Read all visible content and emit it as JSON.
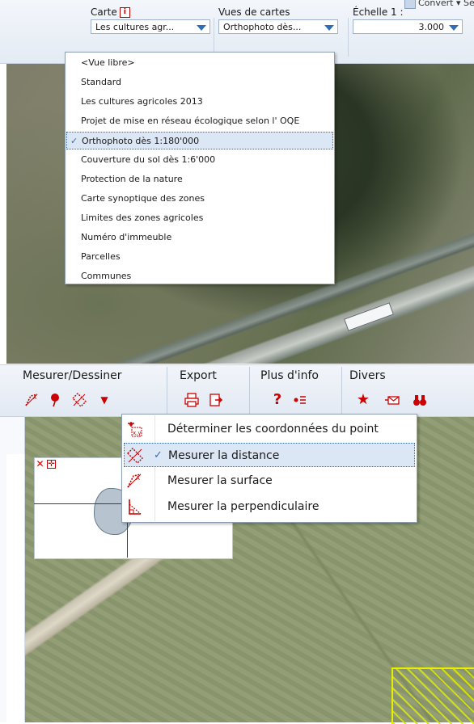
{
  "top_toolbar": {
    "clipped_text": "Convert ▾  Sélect",
    "carte": {
      "label": "Carte",
      "info_icon": "i",
      "selected": "Les cultures agr..."
    },
    "vues": {
      "label": "Vues de cartes",
      "selected": "Orthophoto dès..."
    },
    "echelle": {
      "label": "Échelle 1 :",
      "value": "3.000"
    }
  },
  "map_view_menu": {
    "items": [
      "<Vue libre>",
      "Standard",
      "Les cultures agricoles 2013",
      "Projet de mise en réseau écologique selon l' OQE",
      "Orthophoto dès 1:180'000",
      "Couverture du sol dès 1:6'000",
      "Protection de la nature",
      "Carte synoptique des zones",
      "Limites des zones agricoles",
      "Numéro d'immeuble",
      "Parcelles",
      "Communes"
    ],
    "selected_index": 4,
    "check": "✓"
  },
  "measure_toolbar": {
    "groups": {
      "measure": "Mesurer/Dessiner",
      "export": "Export",
      "info": "Plus d'info",
      "divers": "Divers"
    }
  },
  "tool_menu": {
    "items": [
      {
        "label": "Déterminer les coordonnées du point",
        "icon": "coordinates-icon"
      },
      {
        "label": "Mesurer la distance",
        "icon": "distance-icon"
      },
      {
        "label": "Mesurer la surface",
        "icon": "area-icon"
      },
      {
        "label": "Mesurer la perpendiculaire",
        "icon": "perpendicular-icon"
      }
    ],
    "selected_index": 1,
    "check": "✓"
  },
  "coord_panel": {
    "close": "✕",
    "pan": "✛"
  },
  "colors": {
    "accent": "#2f6db5",
    "icon_red": "#c00000",
    "selection_bg": "#dce7f5"
  }
}
